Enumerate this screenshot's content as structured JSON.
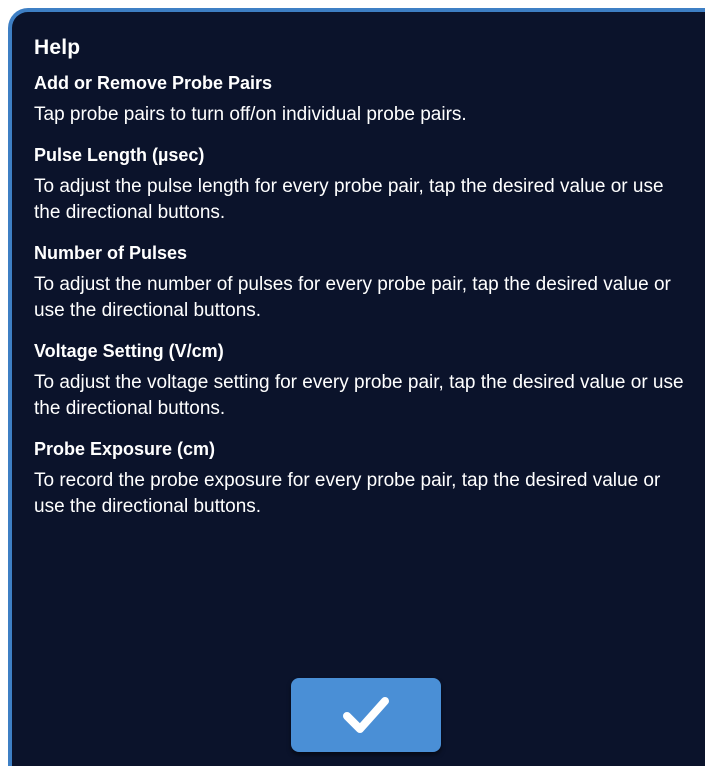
{
  "dialog": {
    "title": "Help",
    "sections": [
      {
        "heading": "Add or Remove Probe Pairs",
        "body": "Tap probe pairs to turn off/on individual probe pairs."
      },
      {
        "heading": "Pulse Length (µsec)",
        "body": "To adjust the pulse length for every probe pair, tap the desired value or use the directional buttons."
      },
      {
        "heading": "Number of Pulses",
        "body": "To adjust the number of pulses for every probe pair, tap the desired value or use the directional buttons."
      },
      {
        "heading": "Voltage Setting (V/cm)",
        "body": "To adjust the voltage setting for every probe pair, tap the desired value or use the directional buttons."
      },
      {
        "heading": "Probe Exposure (cm)",
        "body": "To record the probe exposure for every probe pair, tap the desired value or use the directional buttons."
      }
    ],
    "confirm_button": {
      "icon": "checkmark-icon"
    }
  },
  "colors": {
    "background": "#0b132b",
    "border_accent": "#3e7fc4",
    "button": "#4a8fd6",
    "text": "#ffffff"
  }
}
